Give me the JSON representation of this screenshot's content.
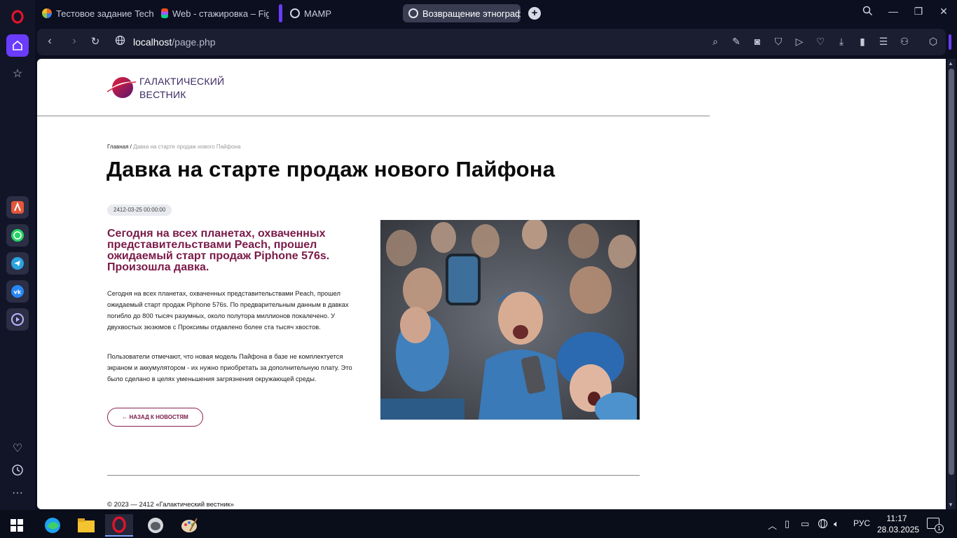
{
  "browser": {
    "tabs": [
      {
        "label": "Тестовое задание Techart",
        "icon_color": "#e86b2a"
      },
      {
        "label": "Web - стажировка – Figma",
        "icon_color": "#a259ff"
      },
      {
        "label": "MAMP",
        "icon_color": "#cfd1df"
      },
      {
        "label": "Возвращение этнографа",
        "icon_color": "#cfd1df"
      }
    ],
    "url_host": "localhost",
    "url_path": "/page.php"
  },
  "site": {
    "logo_line1": "ГАЛАКТИЧЕСКИЙ",
    "logo_line2": "ВЕСТНИК"
  },
  "article": {
    "breadcrumb_home": "Главная",
    "breadcrumb_sep": " / ",
    "breadcrumb_current": "Давка на старте продаж нового Пайфона",
    "title": "Давка на старте продаж нового Пайфона",
    "date": "2412-03-25 00:00:00",
    "lead": "Сегодня на всех планетах, охваченных представительствами Peach, прошел ожидаемый старт продаж Piphone 576s. Произошла давка.",
    "paragraph1": "Сегодня на всех планетах, охваченных представительствами Peach, прошел ожидаемый старт продаж Piphone 576s. По предварительным данным в давках погибло до 800 тысяч разумных, около полутора миллионов покалечено. У двухвостых зюзюмов с Проксимы отдавлено более ста тысяч хвостов.",
    "paragraph2": "Пользователи отмечают, что новая модель Пайфона в базе не комплектуется экраном и аккумулятором - их нужно приобретать за дополнительную плату. Это было сделано в целях уменьшения загрязнения окружающей среды.",
    "back_label": "← НАЗАД К НОВОСТЯМ"
  },
  "footer": {
    "copyright": "© 2023 — 2412 «Галактический вестник»"
  },
  "taskbar": {
    "lang": "РУС",
    "time": "11:17",
    "date": "28.03.2025",
    "notif_count": "1"
  },
  "colors": {
    "accent": "#7a1a48",
    "opera_red": "#e0142b",
    "browser_purple": "#6a3cff"
  }
}
